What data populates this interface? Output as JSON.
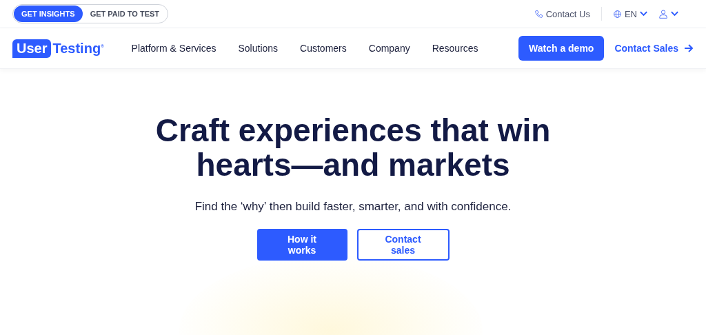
{
  "audience_toggle": [
    {
      "label": "GET INSIGHTS",
      "selected": true
    },
    {
      "label": "GET PAID TO TEST",
      "selected": false
    }
  ],
  "utility_links": {
    "contact": "Contact Us",
    "language": "EN"
  },
  "logo": {
    "badge": "User",
    "text": "Testing$^{®}$"
  },
  "nav": {
    "items": [
      "Platform & Services",
      "Solutions",
      "Customers",
      "Company",
      "Resources"
    ],
    "primary_button": "Watch a demo",
    "secondary_link": "Contact Sales"
  },
  "hero": {
    "headline": [
      "Craft experiences that win",
      "hearts—and markets"
    ],
    "subtitle": "Find the ‘why’ then build faster, smarter, and with confidence.",
    "buttons": [
      {
        "label": "How it works",
        "kind": "primary"
      },
      {
        "label": "Contact sales",
        "kind": "outline"
      }
    ]
  }
}
